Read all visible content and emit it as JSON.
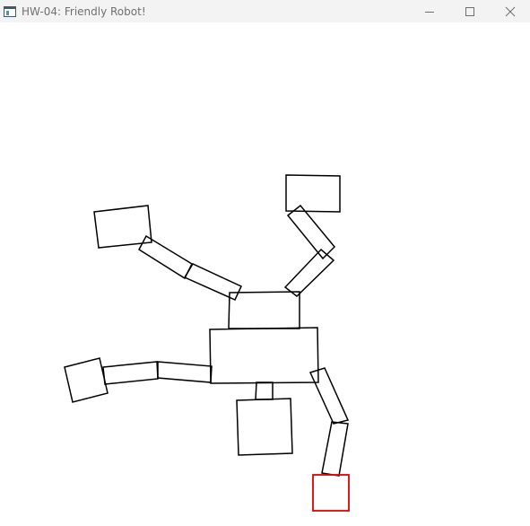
{
  "window": {
    "title": "HW-04: Friendly Robot!",
    "controls": {
      "minimize_icon": "minimize-icon",
      "maximize_icon": "maximize-icon",
      "close_icon": "close-icon"
    }
  },
  "canvas": {
    "background": "#ffffff",
    "stroke_color": "#000000",
    "selected_color": "#e00000",
    "selected_part": "right-foot"
  }
}
